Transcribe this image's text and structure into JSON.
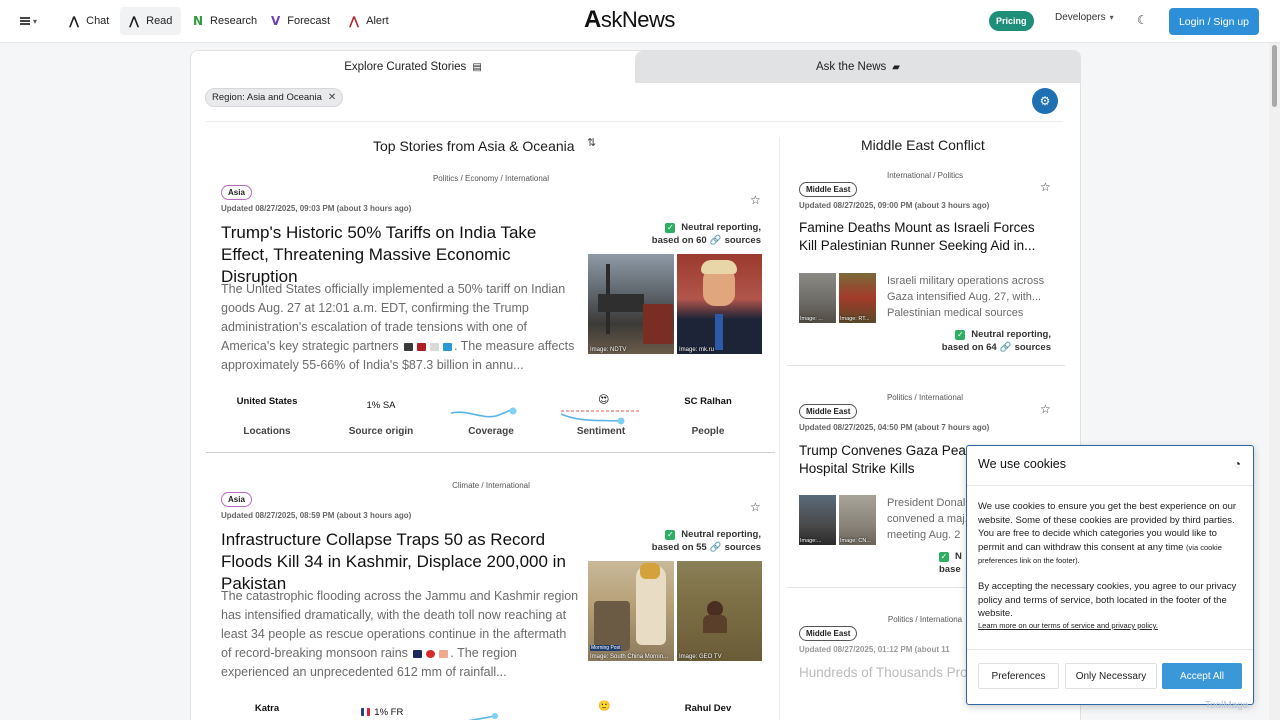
{
  "nav": {
    "items": [
      {
        "icon": "askn-a-icon",
        "label": "Chat"
      },
      {
        "icon": "askn-a-icon",
        "label": "Read"
      },
      {
        "icon": "research-n-icon",
        "label": "Research"
      },
      {
        "icon": "forecast-v-icon",
        "label": "Forecast"
      },
      {
        "icon": "alert-a-icon",
        "label": "Alert"
      }
    ],
    "logo_a": "A",
    "logo_rest": "skNews",
    "pricing": "Pricing",
    "developers": "Developers",
    "login": "Login / Sign up"
  },
  "tabs": {
    "explore": "Explore Curated Stories",
    "ask": "Ask the News"
  },
  "filter_chip": "Region: Asia and Oceania",
  "left": {
    "title": "Top Stories from Asia & Oceania",
    "stories": [
      {
        "categories": "Politics / Economy / International",
        "region": "Asia",
        "updated": "Updated 08/27/2025, 09:03 PM (about 3 hours ago)",
        "headline": "Trump's Historic 50% Tariffs on India Take Effect, Threatening Massive Economic Disruption",
        "summary": "The United States officially implemented a 50% tariff on Indian goods Aug. 27 at 12:01 a.m. EDT, confirming the Trump administration's escalation of trade tensions with one of America's key strategic partners",
        "summary_tail": ". The measure affects approximately 55-66% of India's $87.3 billion in annu...",
        "reporting": "Neutral reporting,",
        "sources_prefix": "based on 60",
        "sources_suffix": "sources",
        "img1_caption": "Image: NDTV",
        "img2_caption": "Image: mk.ru",
        "stats": {
          "locations_val": "United States",
          "locations_lab": "Locations",
          "origin_val": "1% SA",
          "origin_lab": "Source origin",
          "coverage_lab": "Coverage",
          "sentiment_lab": "Sentiment",
          "people_val": "SC Ralhan",
          "people_lab": "People"
        }
      },
      {
        "categories": "Climate / International",
        "region": "Asia",
        "updated": "Updated 08/27/2025, 08:59 PM (about 3 hours ago)",
        "headline": "Infrastructure Collapse Traps 50 as Record Floods Kill 34 in Kashmir, Displace 200,000 in Pakistan",
        "summary": "The catastrophic flooding across the Jammu and Kashmir region has intensified dramatically, with the death toll now reaching at least 34 people as rescue operations continue in the aftermath of record-breaking monsoon rains",
        "summary_tail": ". The region experienced an unprecedented 612 mm of rainfall...",
        "reporting": "Neutral reporting,",
        "sources_prefix": "based on 55",
        "sources_suffix": "sources",
        "img1_caption": "Image: South China Mornin...",
        "img1_tag": "Morning Post",
        "img2_caption": "Image: GEO TV",
        "stats": {
          "locations_val": "Katra",
          "origin_val": "1% FR",
          "people_val": "Rahul Dev"
        }
      }
    ]
  },
  "right": {
    "title": "Middle East Conflict",
    "stories": [
      {
        "categories": "International / Politics",
        "region": "Middle East",
        "updated": "Updated 08/27/2025, 09:00 PM (about 3 hours ago)",
        "headline": "Famine Deaths Mount as Israeli Forces Kill Palestinian Runner Seeking Aid in...",
        "summary": "Israeli military operations across Gaza intensified Aug. 27, with... Palestinian medical sources",
        "reporting": "Neutral reporting,",
        "sources_prefix": "based on 64",
        "sources_suffix": "sources",
        "img1_caption": "Image: ...",
        "img2_caption": "Image: RT..."
      },
      {
        "categories": "Politics / International",
        "region": "Middle East",
        "updated": "Updated 08/27/2025, 04:50 PM (about 7 hours ago)",
        "headline": "Trump Convenes Gaza Peac... as Israeli Hospital Strike Kills",
        "summary": "President Donal... convened a maj... meeting Aug. 2",
        "reporting": "N",
        "sources_prefix": "base",
        "img1_caption": "Image:...",
        "img2_caption": "Image: CN..."
      },
      {
        "categories": "Politics / Internationa",
        "region": "Middle East",
        "updated": "Updated 08/27/2025, 01:12 PM (about 11",
        "headline": "Hundreds of Thousands Pro"
      }
    ]
  },
  "cookie": {
    "title": "We use cookies",
    "p1": "We use cookies to ensure you get the best experience on our website. Some of these cookies are provided by third parties. You are free to decide which categories you would like to permit and can withdraw this consent at any time",
    "p1_small": "(via cookie preferences link on the footer).",
    "p2": "By accepting the necessary cookies, you agree to our privacy policy and terms of service, both located in the footer of the website.",
    "link": "Learn more on our terms of service and privacy policy.",
    "preferences": "Preferences",
    "only_necessary": "Only Necessary",
    "accept_all": "Accept All"
  },
  "watermark": "ToolMage",
  "colors": {
    "accent": "#2e8fd9",
    "pricing": "#1f8f7a",
    "neutral_check": "#2eae63",
    "asia_badge": "#b968c7"
  }
}
